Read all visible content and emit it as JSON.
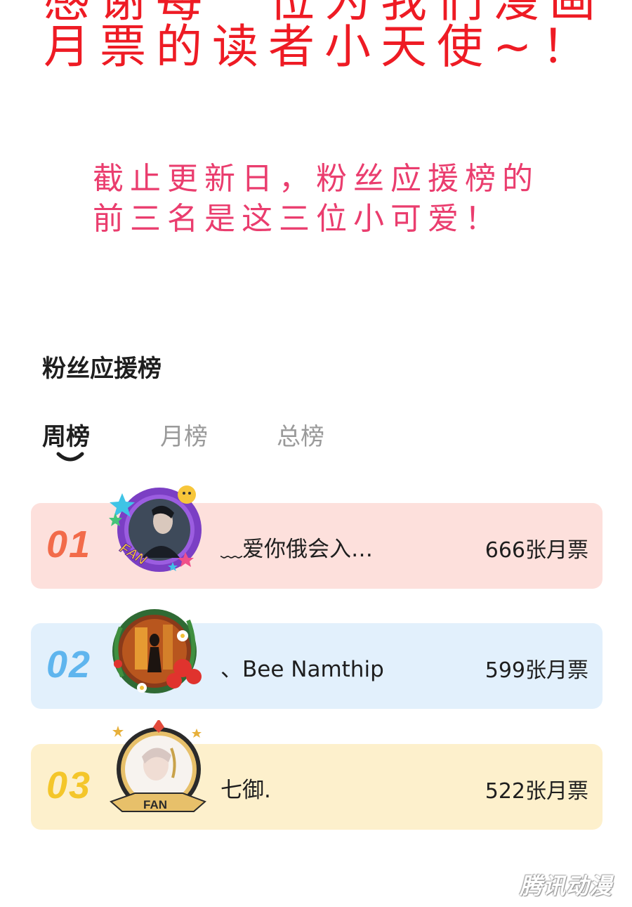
{
  "headline": {
    "line1": "感谢每一位为我们漫画",
    "line2": "月票的读者小天使~！"
  },
  "subline": {
    "line1": "截止更新日，粉丝应援榜的",
    "line2": "前三名是这三位小可爱！"
  },
  "leaderboard": {
    "title": "粉丝应援榜",
    "tabs": [
      "周榜",
      "月榜",
      "总榜"
    ],
    "active_tab": "周榜",
    "rows": [
      {
        "rank": "01",
        "name": "﹏爱你俄会入…",
        "tickets": "666张月票",
        "color": "#f26b4a",
        "bg": "#fde0dc"
      },
      {
        "rank": "02",
        "name": "、Bee Namthip",
        "tickets": "599张月票",
        "color": "#5fb5ee",
        "bg": "#e2f0fc"
      },
      {
        "rank": "03",
        "name": "七御.",
        "tickets": "522张月票",
        "color": "#f4c62a",
        "bg": "#fdf0cc"
      }
    ]
  },
  "avatar_badges": [
    "FAN",
    "FAN"
  ],
  "watermark": "腾讯动漫",
  "colors": {
    "headline": "#ee1b24",
    "subline": "#ea3d6e"
  }
}
